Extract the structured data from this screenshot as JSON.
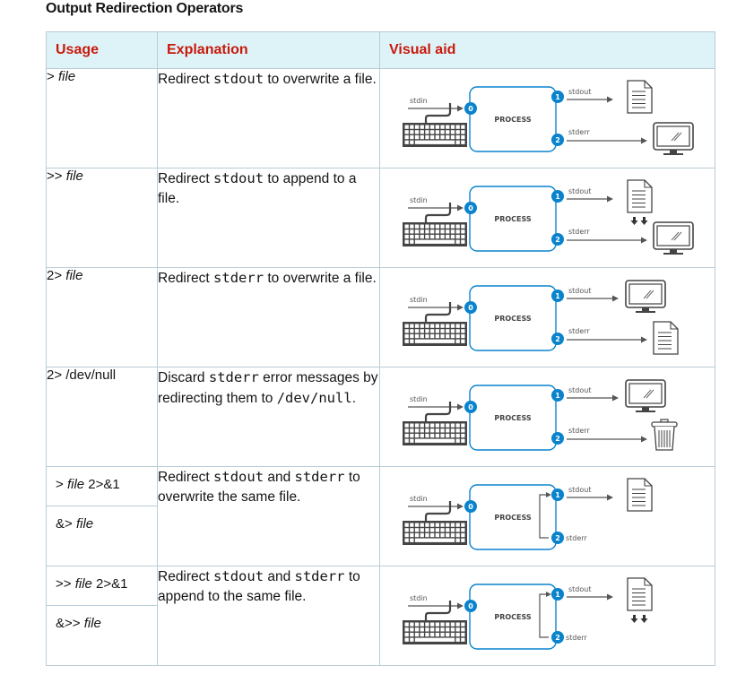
{
  "title": "Output Redirection Operators",
  "headers": {
    "usage": "Usage",
    "explanation": "Explanation",
    "visual": "Visual aid"
  },
  "diagram_labels": {
    "stdin": "stdin",
    "stdout": "stdout",
    "stderr": "stderr",
    "process": "PROCESS",
    "fd0": "0",
    "fd1": "1",
    "fd2": "2"
  },
  "colors": {
    "header_text": "#c9190b",
    "header_bg": "#def3f8",
    "accent": "#0a83cd",
    "border": "#b9ccd6"
  },
  "rows": [
    {
      "usage": [
        {
          "op": "> ",
          "arg": "file",
          "suffix": ""
        }
      ],
      "explanation": [
        {
          "t": "Redirect "
        },
        {
          "m": "stdout"
        },
        {
          "t": " to overwrite a file."
        }
      ],
      "stdout_target": "file",
      "stderr_target": "terminal"
    },
    {
      "usage": [
        {
          "op": ">> ",
          "arg": "file",
          "suffix": ""
        }
      ],
      "explanation": [
        {
          "t": "Redirect "
        },
        {
          "m": "stdout"
        },
        {
          "t": " to append to a file."
        }
      ],
      "stdout_target": "file-append",
      "stderr_target": "terminal"
    },
    {
      "usage": [
        {
          "op": "2> ",
          "arg": "file",
          "suffix": ""
        }
      ],
      "explanation": [
        {
          "t": "Redirect "
        },
        {
          "m": "stderr"
        },
        {
          "t": " to overwrite a file."
        }
      ],
      "stdout_target": "terminal",
      "stderr_target": "file"
    },
    {
      "usage": [
        {
          "op": "2> /dev/null",
          "arg": "",
          "suffix": ""
        }
      ],
      "explanation": [
        {
          "t": "Discard "
        },
        {
          "m": "stderr"
        },
        {
          "t": " error messages by redirecting them to "
        },
        {
          "m": "/dev/null"
        },
        {
          "t": "."
        }
      ],
      "stdout_target": "terminal",
      "stderr_target": "trash"
    },
    {
      "usage": [
        {
          "op": "> ",
          "arg": "file",
          "suffix": " 2>&1"
        },
        {
          "op": "&> ",
          "arg": "file",
          "suffix": ""
        }
      ],
      "explanation": [
        {
          "t": "Redirect "
        },
        {
          "m": "stdout"
        },
        {
          "t": " and "
        },
        {
          "m": "stderr"
        },
        {
          "t": " to overwrite the same file."
        }
      ],
      "stdout_target": "file",
      "stderr_target": "merged"
    },
    {
      "usage": [
        {
          "op": ">> ",
          "arg": "file",
          "suffix": " 2>&1"
        },
        {
          "op": "&>> ",
          "arg": "file",
          "suffix": ""
        }
      ],
      "explanation": [
        {
          "t": "Redirect "
        },
        {
          "m": "stdout"
        },
        {
          "t": " and "
        },
        {
          "m": "stderr"
        },
        {
          "t": " to append to the same file."
        }
      ],
      "stdout_target": "file-append",
      "stderr_target": "merged"
    }
  ]
}
